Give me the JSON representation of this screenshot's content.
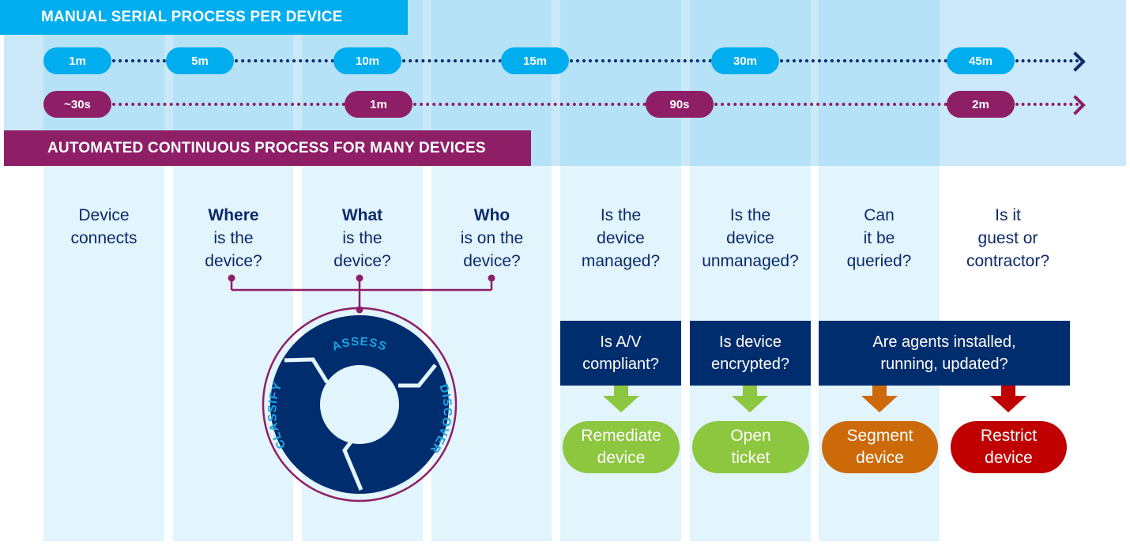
{
  "banners": {
    "manual": "MANUAL SERIAL PROCESS PER DEVICE",
    "automated": "AUTOMATED CONTINUOUS PROCESS FOR MANY DEVICES"
  },
  "timelines": {
    "manual": [
      "1m",
      "5m",
      "10m",
      "15m",
      "30m",
      "45m"
    ],
    "automated": [
      "~30s",
      "1m",
      "90s",
      "2m"
    ]
  },
  "colors": {
    "manual_blue": "#00adee",
    "automated_purple": "#8e1f67",
    "navy": "#002d6e",
    "remediate_green": "#8dc63f",
    "segment_orange": "#cc6a0a",
    "restrict_red": "#c00000"
  },
  "questions": [
    {
      "bold": "",
      "lines": [
        "Device",
        "connects"
      ]
    },
    {
      "bold": "Where",
      "lines": [
        "is the",
        "device?"
      ]
    },
    {
      "bold": "What",
      "lines": [
        "is the",
        "device?"
      ]
    },
    {
      "bold": "Who",
      "lines": [
        "is on the",
        "device?"
      ]
    },
    {
      "bold": "",
      "lines": [
        "Is the",
        "device",
        "managed?"
      ]
    },
    {
      "bold": "",
      "lines": [
        "Is the",
        "device",
        "unmanaged?"
      ]
    },
    {
      "bold": "",
      "lines": [
        "Can",
        "it be",
        "queried?"
      ]
    },
    {
      "bold": "",
      "lines": [
        "Is it",
        "guest or",
        "contractor?"
      ]
    }
  ],
  "cycle": {
    "steps": [
      "ASSESS",
      "DISCOVER",
      "CLASSIFY"
    ]
  },
  "checks": [
    {
      "lines": [
        "Is A/V",
        "compliant?"
      ]
    },
    {
      "lines": [
        "Is device",
        "encrypted?"
      ]
    },
    {
      "lines": [
        "Are agents installed,",
        "running, updated?"
      ]
    }
  ],
  "actions": [
    {
      "lines": [
        "Remediate",
        "device"
      ],
      "color": "#8dc63f"
    },
    {
      "lines": [
        "Open",
        "ticket"
      ],
      "color": "#8dc63f"
    },
    {
      "lines": [
        "Segment",
        "device"
      ],
      "color": "#cc6a0a"
    },
    {
      "lines": [
        "Restrict",
        "device"
      ],
      "color": "#c00000"
    }
  ]
}
